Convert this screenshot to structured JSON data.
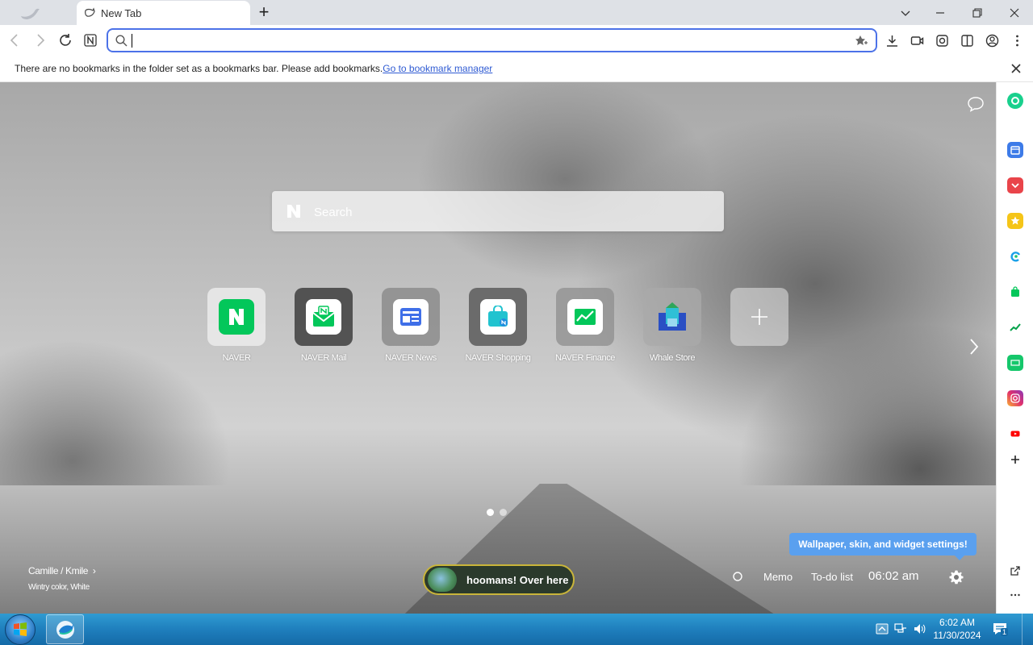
{
  "browser": {
    "tab": {
      "title": "New Tab"
    },
    "address_bar": {
      "value": ""
    },
    "bookmarks_notice": {
      "text": "There are no bookmarks in the folder set as a bookmarks bar. Please add bookmarks.",
      "link": "Go to bookmark manager"
    }
  },
  "new_tab": {
    "search": {
      "placeholder": "Search"
    },
    "shortcuts": [
      {
        "label": "NAVER",
        "icon": "naver-icon"
      },
      {
        "label": "NAVER Mail",
        "icon": "naver-mail-icon"
      },
      {
        "label": "NAVER News",
        "icon": "naver-news-icon"
      },
      {
        "label": "NAVER Shopping",
        "icon": "naver-shopping-icon"
      },
      {
        "label": "NAVER Finance",
        "icon": "naver-finance-icon"
      },
      {
        "label": "Whale Store",
        "icon": "whale-store-icon"
      },
      {
        "label": "",
        "icon": "add-shortcut-icon"
      }
    ],
    "wallpaper_credit": {
      "name": "Camille / Kmile",
      "subtitle": "Wintry color, White"
    },
    "news_pill": {
      "text": "hoomans! Over here"
    },
    "widgets": {
      "memo": "Memo",
      "todo": "To-do list",
      "time": "06:02 am"
    },
    "settings_tooltip": "Wallpaper, skin, and widget settings!"
  },
  "taskbar": {
    "time": "6:02 AM",
    "date": "11/30/2024",
    "notification_count": "1"
  },
  "colors": {
    "accent": "#4c72e8",
    "naver_green": "#03c75a",
    "tooltip_blue": "#5aa0ef",
    "link_blue": "#2f5bd3"
  }
}
